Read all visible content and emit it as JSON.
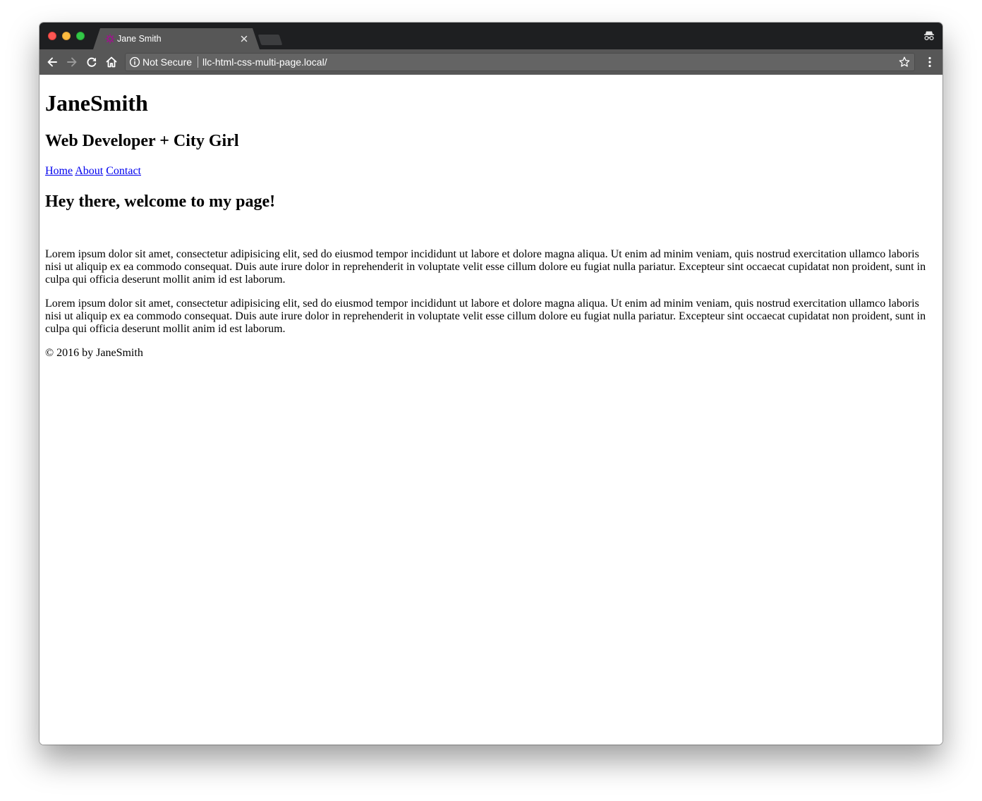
{
  "browser": {
    "tab": {
      "title": "Jane Smith",
      "favicon_icon": "gear-icon",
      "favicon_color": "#a0138e",
      "close_icon": "close-icon"
    },
    "toolbar": {
      "back_icon": "arrow-left-icon",
      "forward_icon": "arrow-right-icon",
      "reload_icon": "reload-icon",
      "home_icon": "home-icon",
      "menu_icon": "more-vertical-icon"
    },
    "omnibox": {
      "info_icon": "info-icon",
      "security_label": "Not Secure",
      "url": "llc-html-css-multi-page.local/",
      "bookmark_icon": "star-icon"
    },
    "incognito_icon": "incognito-icon"
  },
  "page": {
    "site_name": "JaneSmith",
    "tagline": "Web Developer + City Girl",
    "nav": [
      {
        "label": "Home"
      },
      {
        "label": "About"
      },
      {
        "label": "Contact"
      }
    ],
    "heading": "Hey there, welcome to my page!",
    "paragraphs": [
      "Lorem ipsum dolor sit amet, consectetur adipisicing elit, sed do eiusmod tempor incididunt ut labore et dolore magna aliqua. Ut enim ad minim veniam, quis nostrud exercitation ullamco laboris nisi ut aliquip ex ea commodo consequat. Duis aute irure dolor in reprehenderit in voluptate velit esse cillum dolore eu fugiat nulla pariatur. Excepteur sint occaecat cupidatat non proident, sunt in culpa qui officia deserunt mollit anim id est laborum.",
      "Lorem ipsum dolor sit amet, consectetur adipisicing elit, sed do eiusmod tempor incididunt ut labore et dolore magna aliqua. Ut enim ad minim veniam, quis nostrud exercitation ullamco laboris nisi ut aliquip ex ea commodo consequat. Duis aute irure dolor in reprehenderit in voluptate velit esse cillum dolore eu fugiat nulla pariatur. Excepteur sint occaecat cupidatat non proident, sunt in culpa qui officia deserunt mollit anim id est laborum."
    ],
    "footer": "© 2016 by JaneSmith",
    "link_color": "#0000ee"
  }
}
